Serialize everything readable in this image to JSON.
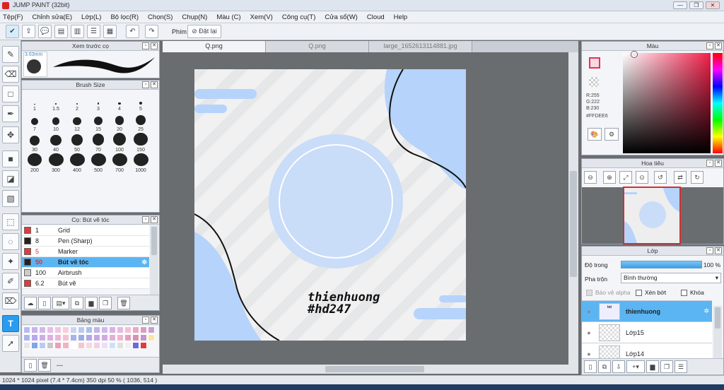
{
  "window": {
    "title": "JUMP PAINT (32bit)",
    "min": "—",
    "restore": "❐",
    "close": "✕"
  },
  "menu": [
    "Tệp(F)",
    "Chỉnh sửa(E)",
    "Lớp(L)",
    "Bộ lọc(R)",
    "Chọn(S)",
    "Chụp(N)",
    "Màu (C)",
    "Xem(V)",
    "Công cụ(T)",
    "Cửa sổ(W)",
    "Cloud",
    "Help"
  ],
  "toolbar": {
    "hotkey_label": "Phím",
    "reset_label": "Đặt lại"
  },
  "brush_preview": {
    "title": "Xem trước cọ",
    "size": "3.63mm"
  },
  "brush_size": {
    "title": "Brush Size",
    "sizes": [
      "1",
      "1.5",
      "2",
      "3",
      "4",
      "5",
      "7",
      "10",
      "12",
      "15",
      "20",
      "25",
      "30",
      "40",
      "50",
      "70",
      "100",
      "150",
      "200",
      "300",
      "400",
      "500",
      "700",
      "1000"
    ]
  },
  "brushes": {
    "title": "Cọ: Bút vẽ tóc",
    "items": [
      {
        "size": "1",
        "name": "Grid",
        "color": "#e23b3b"
      },
      {
        "size": "8",
        "name": "Pen (Sharp)",
        "color": "#222222"
      },
      {
        "size": "5",
        "name": "Marker",
        "color": "#e23b3b"
      },
      {
        "size": "50",
        "name": "Bút vẽ tóc",
        "color": "#222222"
      },
      {
        "size": "100",
        "name": "Airbrush",
        "color": "#cccccc"
      },
      {
        "size": "6.2",
        "name": "Bút vẽ",
        "color": "#e23b3b"
      }
    ]
  },
  "palette": {
    "title": "Bảng màu",
    "footer_text": "---"
  },
  "tabs": [
    "Q.png",
    "Q.png",
    "large_1652613114881.jpg"
  ],
  "canvas": {
    "text_line1": "thienhuong",
    "text_line2": "#hd247"
  },
  "color_panel": {
    "title": "Màu",
    "r": "R:255",
    "g": "G:222",
    "b": "B:230",
    "hex": "#FFDEE6",
    "fg": "#FFDEE6"
  },
  "navigator": {
    "title": "Hoa tiêu"
  },
  "layers": {
    "title": "Lớp",
    "opacity_label": "Độ trong",
    "opacity_value": "100 %",
    "blend_label": "Pha trộn",
    "blend_value": "Bình thường",
    "protect_alpha": "Bảo vệ alpha",
    "clip": "Xén bớt",
    "lock": "Khóa",
    "items": [
      {
        "name": "thienhuong"
      },
      {
        "name": "Lớp15"
      },
      {
        "name": "Lớp14"
      }
    ]
  },
  "status": {
    "text": "1024 * 1024 pixel   (7.4 * 7.4cm)   350 dpi   50 %   ( 1036, 514 )"
  }
}
